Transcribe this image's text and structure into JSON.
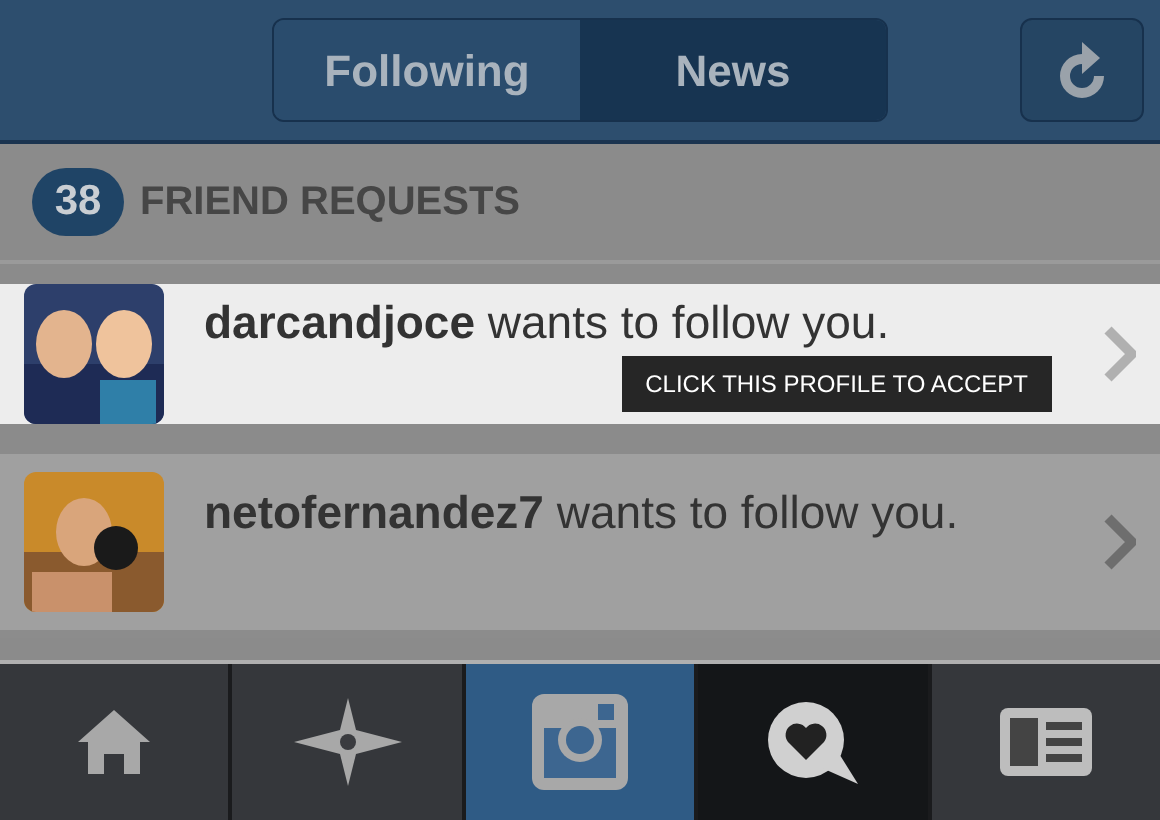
{
  "header": {
    "segments": [
      {
        "label": "Following",
        "selected": false
      },
      {
        "label": "News",
        "selected": true
      }
    ]
  },
  "section": {
    "count": "38",
    "title": "FRIEND REQUESTS"
  },
  "requests": [
    {
      "text": "**darcandjoce** wants to follow you.",
      "highlighted": true,
      "hint": "CLICK THIS PROFILE TO ACCEPT"
    },
    {
      "text": "**netofernandez7** wants to follow you.",
      "highlighted": false
    }
  ],
  "tabbar": [
    {
      "kind": "home",
      "selected": false
    },
    {
      "kind": "explore",
      "selected": false
    },
    {
      "kind": "camera",
      "selected": false
    },
    {
      "kind": "activity",
      "selected": true
    },
    {
      "kind": "profile",
      "selected": false
    }
  ]
}
